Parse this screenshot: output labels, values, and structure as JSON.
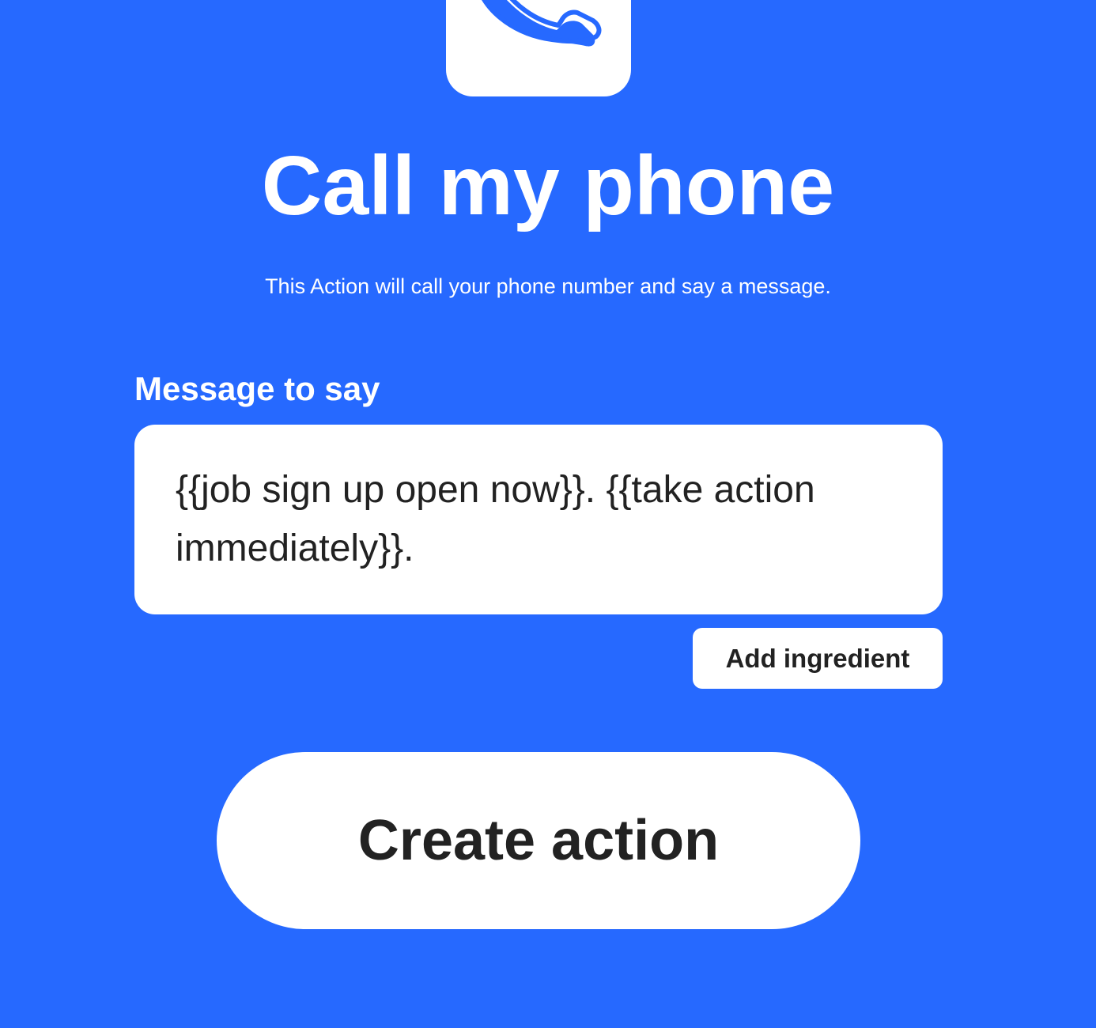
{
  "app": {
    "icon": "phone-icon",
    "icon_color": "#2669FF",
    "background_color": "#2669FF"
  },
  "header": {
    "title": "Call my phone",
    "description": "This Action will call your phone number and say a message."
  },
  "form": {
    "message_label": "Message to say",
    "message_value": "{{job sign up open now}}. {{take action immediately}}.",
    "add_ingredient_label": "Add ingredient"
  },
  "actions": {
    "create_label": "Create action"
  }
}
